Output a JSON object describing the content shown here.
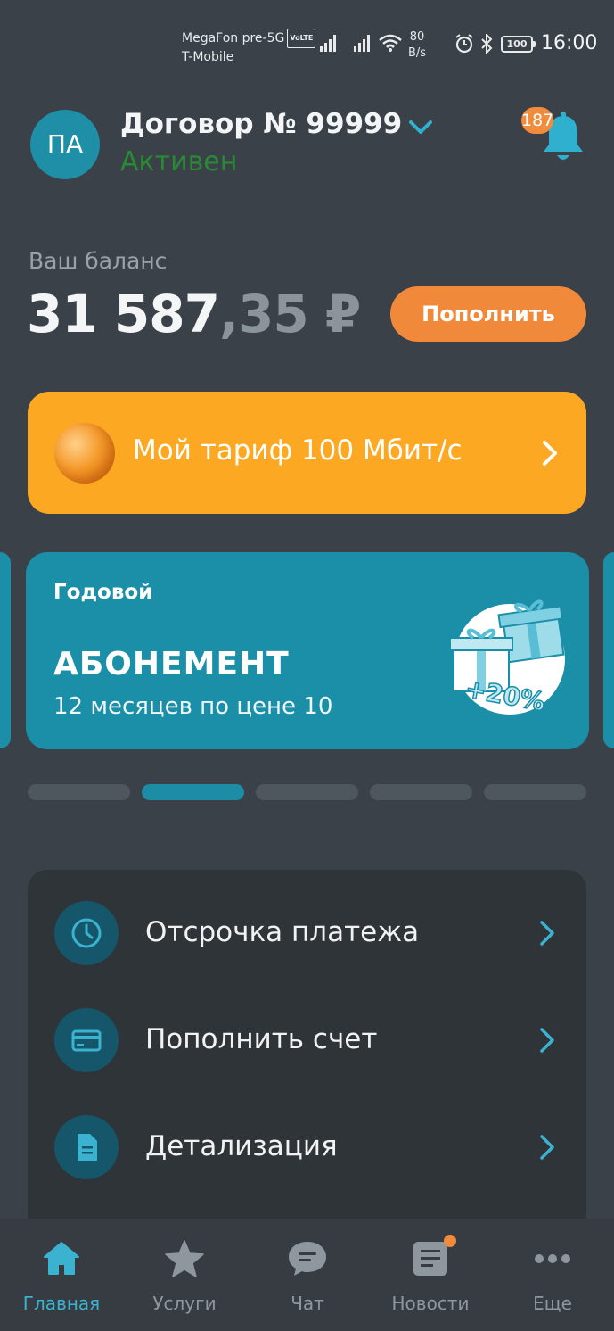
{
  "status_bar": {
    "carrier1": "MegaFon pre-5G",
    "volte": "VoLTE",
    "carrier2": "T-Mobile",
    "speed_value": "80",
    "speed_unit": "B/s",
    "battery": "100",
    "time": "16:00"
  },
  "header": {
    "avatar_initials": "ПА",
    "contract": "Договор № 99999",
    "status": "Активен",
    "notifications_count": "187"
  },
  "balance": {
    "label": "Ваш баланс",
    "integer": "31 587",
    "fraction": ",35 ₽",
    "topup_label": "Пополнить"
  },
  "tariff": {
    "label": "Мой тариф 100 Мбит/с"
  },
  "promo": {
    "small": "Годовой",
    "title": "АБОНЕМЕНТ",
    "subtitle": "12 месяцев по цене 10",
    "gift_text": "+20%"
  },
  "carousel": {
    "active_index": 1,
    "count": 5
  },
  "menu": {
    "items": [
      {
        "label": "Отсрочка платежа",
        "icon": "clock-icon"
      },
      {
        "label": "Пополнить счет",
        "icon": "card-icon"
      },
      {
        "label": "Детализация",
        "icon": "document-icon"
      }
    ]
  },
  "nav": {
    "items": [
      {
        "label": "Главная",
        "icon": "home-icon"
      },
      {
        "label": "Услуги",
        "icon": "star-icon"
      },
      {
        "label": "Чат",
        "icon": "chat-icon"
      },
      {
        "label": "Новости",
        "icon": "news-icon"
      },
      {
        "label": "Еще",
        "icon": "more-icon"
      }
    ]
  },
  "colors": {
    "background": "#3a4148",
    "accent": "#1b8fa8",
    "orange": "#f08a3a",
    "tariff": "#fda822",
    "active_status": "#2a8a34"
  }
}
